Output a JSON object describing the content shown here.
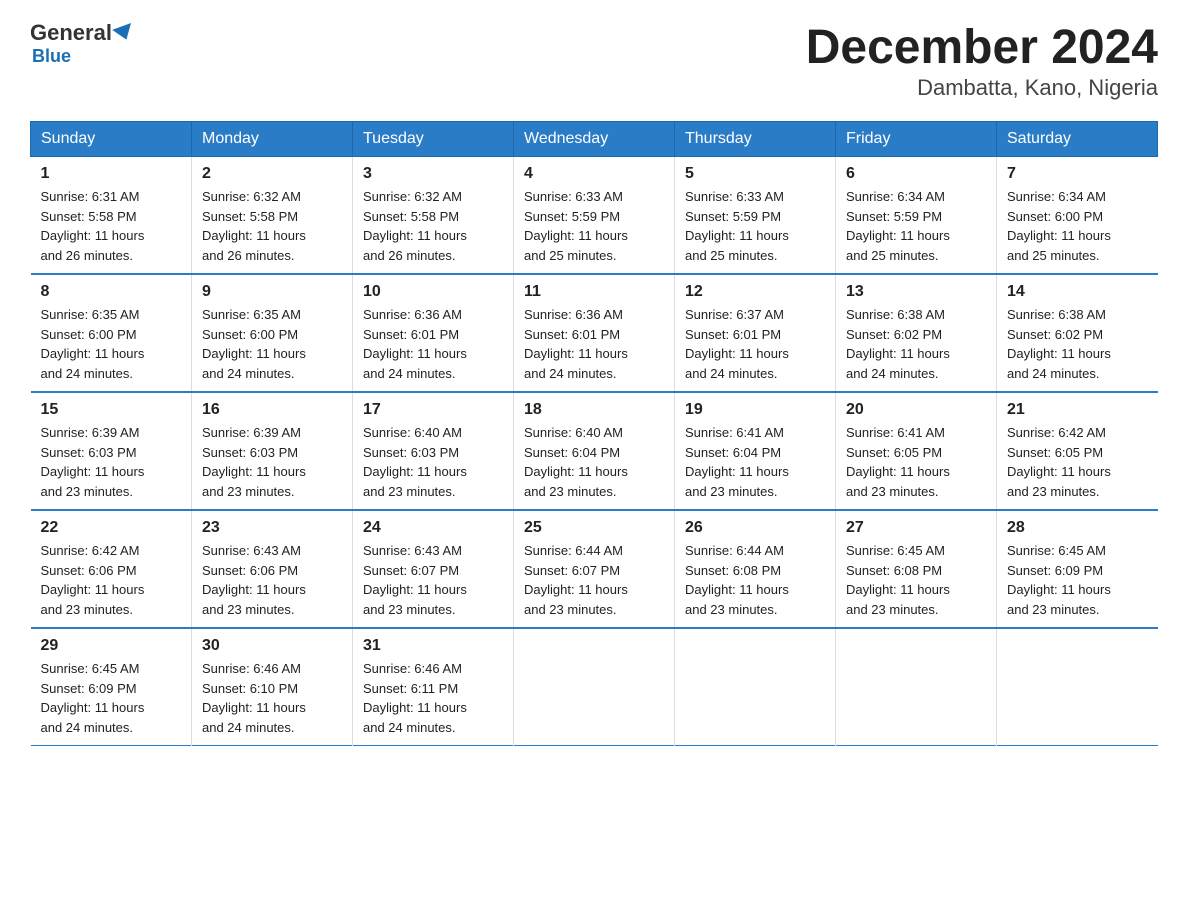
{
  "logo": {
    "general": "General",
    "blue": "Blue"
  },
  "title": "December 2024",
  "subtitle": "Dambatta, Kano, Nigeria",
  "days_of_week": [
    "Sunday",
    "Monday",
    "Tuesday",
    "Wednesday",
    "Thursday",
    "Friday",
    "Saturday"
  ],
  "weeks": [
    [
      {
        "day": "1",
        "info": "Sunrise: 6:31 AM\nSunset: 5:58 PM\nDaylight: 11 hours\nand 26 minutes."
      },
      {
        "day": "2",
        "info": "Sunrise: 6:32 AM\nSunset: 5:58 PM\nDaylight: 11 hours\nand 26 minutes."
      },
      {
        "day": "3",
        "info": "Sunrise: 6:32 AM\nSunset: 5:58 PM\nDaylight: 11 hours\nand 26 minutes."
      },
      {
        "day": "4",
        "info": "Sunrise: 6:33 AM\nSunset: 5:59 PM\nDaylight: 11 hours\nand 25 minutes."
      },
      {
        "day": "5",
        "info": "Sunrise: 6:33 AM\nSunset: 5:59 PM\nDaylight: 11 hours\nand 25 minutes."
      },
      {
        "day": "6",
        "info": "Sunrise: 6:34 AM\nSunset: 5:59 PM\nDaylight: 11 hours\nand 25 minutes."
      },
      {
        "day": "7",
        "info": "Sunrise: 6:34 AM\nSunset: 6:00 PM\nDaylight: 11 hours\nand 25 minutes."
      }
    ],
    [
      {
        "day": "8",
        "info": "Sunrise: 6:35 AM\nSunset: 6:00 PM\nDaylight: 11 hours\nand 24 minutes."
      },
      {
        "day": "9",
        "info": "Sunrise: 6:35 AM\nSunset: 6:00 PM\nDaylight: 11 hours\nand 24 minutes."
      },
      {
        "day": "10",
        "info": "Sunrise: 6:36 AM\nSunset: 6:01 PM\nDaylight: 11 hours\nand 24 minutes."
      },
      {
        "day": "11",
        "info": "Sunrise: 6:36 AM\nSunset: 6:01 PM\nDaylight: 11 hours\nand 24 minutes."
      },
      {
        "day": "12",
        "info": "Sunrise: 6:37 AM\nSunset: 6:01 PM\nDaylight: 11 hours\nand 24 minutes."
      },
      {
        "day": "13",
        "info": "Sunrise: 6:38 AM\nSunset: 6:02 PM\nDaylight: 11 hours\nand 24 minutes."
      },
      {
        "day": "14",
        "info": "Sunrise: 6:38 AM\nSunset: 6:02 PM\nDaylight: 11 hours\nand 24 minutes."
      }
    ],
    [
      {
        "day": "15",
        "info": "Sunrise: 6:39 AM\nSunset: 6:03 PM\nDaylight: 11 hours\nand 23 minutes."
      },
      {
        "day": "16",
        "info": "Sunrise: 6:39 AM\nSunset: 6:03 PM\nDaylight: 11 hours\nand 23 minutes."
      },
      {
        "day": "17",
        "info": "Sunrise: 6:40 AM\nSunset: 6:03 PM\nDaylight: 11 hours\nand 23 minutes."
      },
      {
        "day": "18",
        "info": "Sunrise: 6:40 AM\nSunset: 6:04 PM\nDaylight: 11 hours\nand 23 minutes."
      },
      {
        "day": "19",
        "info": "Sunrise: 6:41 AM\nSunset: 6:04 PM\nDaylight: 11 hours\nand 23 minutes."
      },
      {
        "day": "20",
        "info": "Sunrise: 6:41 AM\nSunset: 6:05 PM\nDaylight: 11 hours\nand 23 minutes."
      },
      {
        "day": "21",
        "info": "Sunrise: 6:42 AM\nSunset: 6:05 PM\nDaylight: 11 hours\nand 23 minutes."
      }
    ],
    [
      {
        "day": "22",
        "info": "Sunrise: 6:42 AM\nSunset: 6:06 PM\nDaylight: 11 hours\nand 23 minutes."
      },
      {
        "day": "23",
        "info": "Sunrise: 6:43 AM\nSunset: 6:06 PM\nDaylight: 11 hours\nand 23 minutes."
      },
      {
        "day": "24",
        "info": "Sunrise: 6:43 AM\nSunset: 6:07 PM\nDaylight: 11 hours\nand 23 minutes."
      },
      {
        "day": "25",
        "info": "Sunrise: 6:44 AM\nSunset: 6:07 PM\nDaylight: 11 hours\nand 23 minutes."
      },
      {
        "day": "26",
        "info": "Sunrise: 6:44 AM\nSunset: 6:08 PM\nDaylight: 11 hours\nand 23 minutes."
      },
      {
        "day": "27",
        "info": "Sunrise: 6:45 AM\nSunset: 6:08 PM\nDaylight: 11 hours\nand 23 minutes."
      },
      {
        "day": "28",
        "info": "Sunrise: 6:45 AM\nSunset: 6:09 PM\nDaylight: 11 hours\nand 23 minutes."
      }
    ],
    [
      {
        "day": "29",
        "info": "Sunrise: 6:45 AM\nSunset: 6:09 PM\nDaylight: 11 hours\nand 24 minutes."
      },
      {
        "day": "30",
        "info": "Sunrise: 6:46 AM\nSunset: 6:10 PM\nDaylight: 11 hours\nand 24 minutes."
      },
      {
        "day": "31",
        "info": "Sunrise: 6:46 AM\nSunset: 6:11 PM\nDaylight: 11 hours\nand 24 minutes."
      },
      {
        "day": "",
        "info": ""
      },
      {
        "day": "",
        "info": ""
      },
      {
        "day": "",
        "info": ""
      },
      {
        "day": "",
        "info": ""
      }
    ]
  ]
}
